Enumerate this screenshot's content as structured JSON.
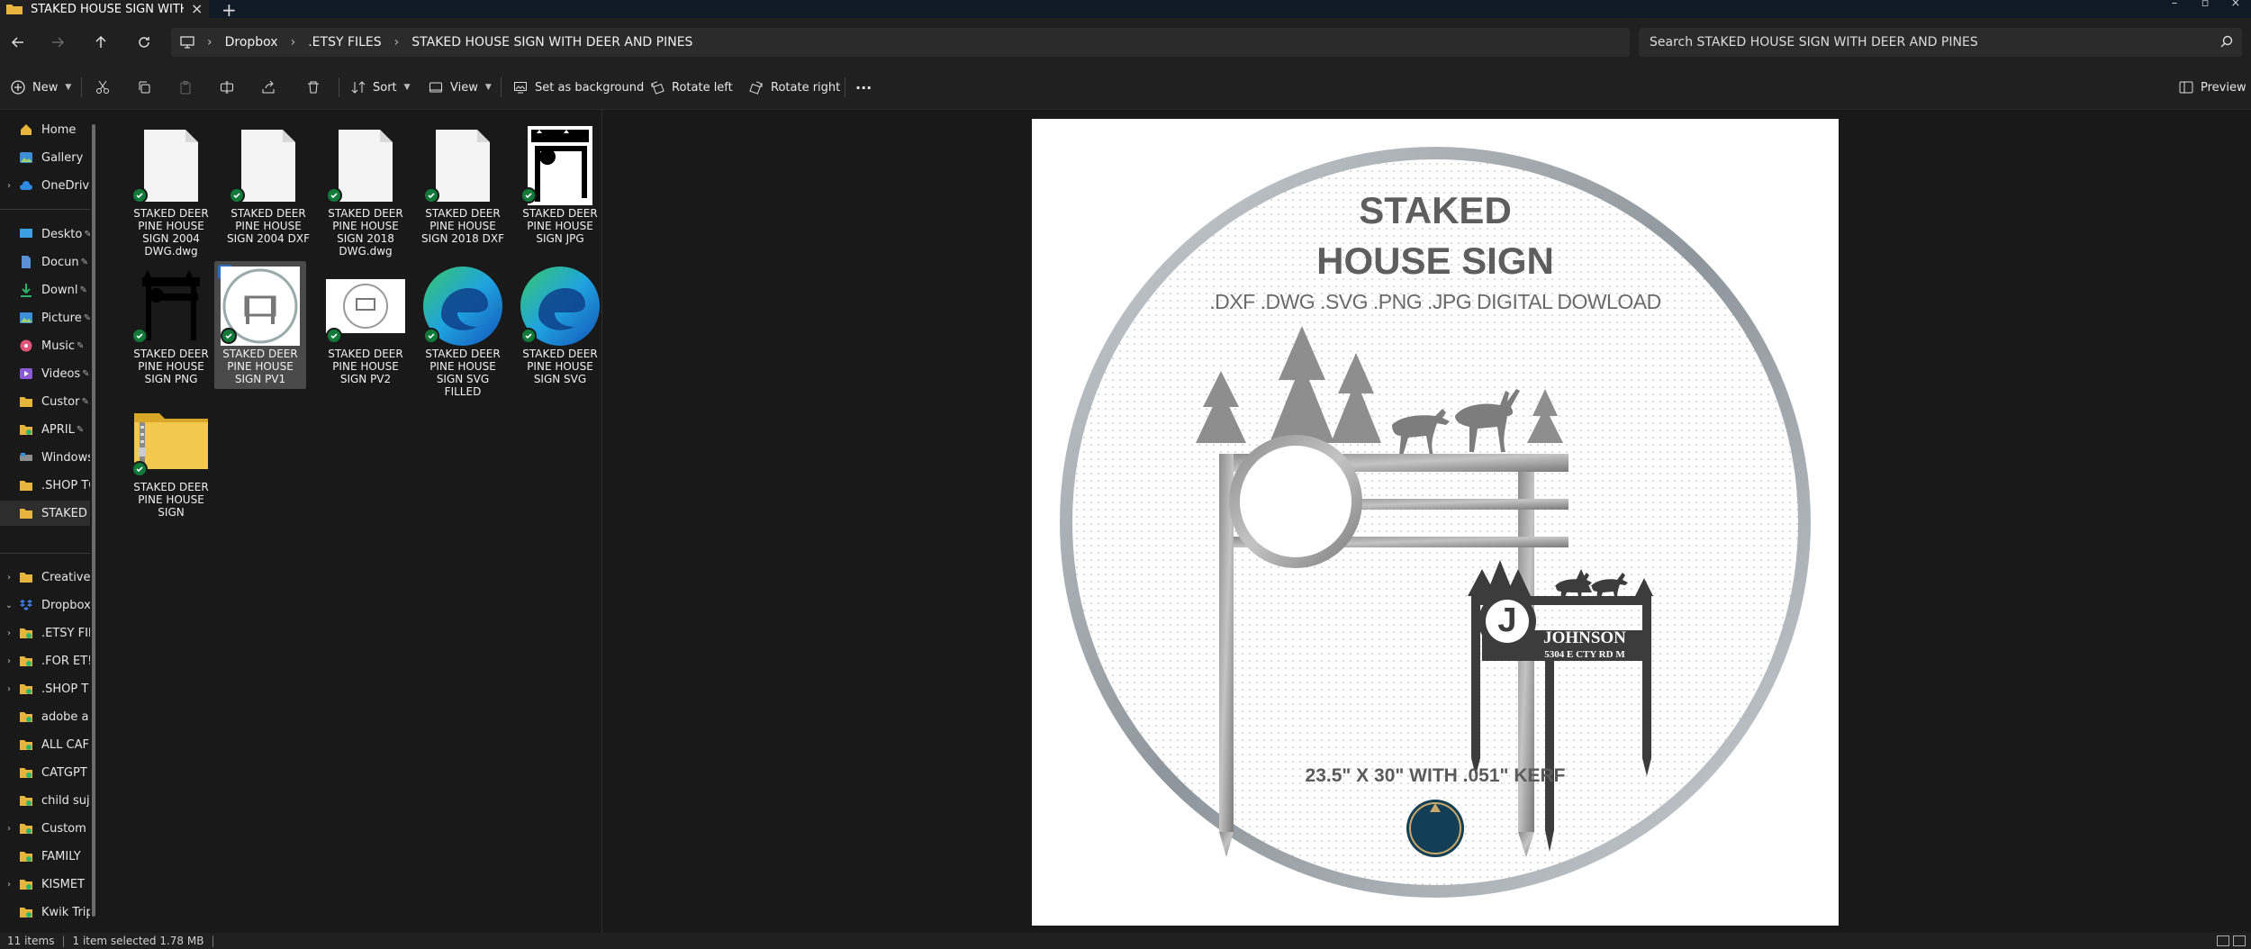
{
  "tab": {
    "title": "STAKED HOUSE SIGN WITH DI"
  },
  "address": {
    "crumbs": [
      "Dropbox",
      ".ETSY FILES",
      "STAKED HOUSE SIGN WITH DEER AND PINES"
    ],
    "search_placeholder": "Search STAKED HOUSE SIGN WITH DEER AND PINES"
  },
  "toolbar": {
    "new": "New",
    "sort": "Sort",
    "view": "View",
    "set_background": "Set as background",
    "rotate_left": "Rotate left",
    "rotate_right": "Rotate right",
    "more": "···",
    "preview": "Preview"
  },
  "sidebar": {
    "items": [
      {
        "label": "Home"
      },
      {
        "label": "Gallery"
      },
      {
        "label": "OneDrive"
      },
      {
        "label": "Deskto"
      },
      {
        "label": "Docun"
      },
      {
        "label": "Downl"
      },
      {
        "label": "Picture"
      },
      {
        "label": "Music"
      },
      {
        "label": "Videos"
      },
      {
        "label": "Custor"
      },
      {
        "label": "APRIL"
      },
      {
        "label": "Windows"
      },
      {
        "label": ".SHOP TO"
      },
      {
        "label": "STAKED H"
      },
      {
        "label": "Creative C"
      },
      {
        "label": "Dropbox"
      },
      {
        "label": ".ETSY FIL"
      },
      {
        "label": ".FOR ET!"
      },
      {
        "label": ".SHOP T"
      },
      {
        "label": "adobe a"
      },
      {
        "label": "ALL CAF"
      },
      {
        "label": "CATGPT"
      },
      {
        "label": "child suj"
      },
      {
        "label": "Custom"
      },
      {
        "label": "FAMILY"
      },
      {
        "label": "KISMET"
      },
      {
        "label": "Kwik Trip"
      }
    ]
  },
  "files": [
    {
      "name": "STAKED DEER PINE HOUSE SIGN 2004 DWG.dwg"
    },
    {
      "name": "STAKED DEER PINE HOUSE SIGN 2004 DXF"
    },
    {
      "name": "STAKED DEER PINE HOUSE SIGN 2018 DWG.dwg"
    },
    {
      "name": "STAKED DEER PINE HOUSE SIGN 2018 DXF"
    },
    {
      "name": "STAKED DEER PINE HOUSE SIGN JPG"
    },
    {
      "name": "STAKED DEER PINE HOUSE SIGN PNG"
    },
    {
      "name": "STAKED DEER PINE HOUSE SIGN PV1"
    },
    {
      "name": "STAKED DEER PINE HOUSE SIGN PV2"
    },
    {
      "name": "STAKED DEER PINE HOUSE SIGN SVG FILLED"
    },
    {
      "name": "STAKED DEER PINE HOUSE SIGN SVG"
    },
    {
      "name": "STAKED DEER PINE HOUSE SIGN"
    }
  ],
  "preview": {
    "title_line1": "STAKED",
    "title_line2": "HOUSE SIGN",
    "formats": ".DXF .DWG .SVG .PNG .JPG DIGITAL DOWLOAD",
    "monogram": "J",
    "family_name": "JOHNSON",
    "address": "5304 E CTY RD M",
    "size_note": "23.5\" X 30\" WITH .051\" KERF"
  },
  "status": {
    "items": "11 items",
    "selected": "1 item selected  1.78 MB"
  }
}
